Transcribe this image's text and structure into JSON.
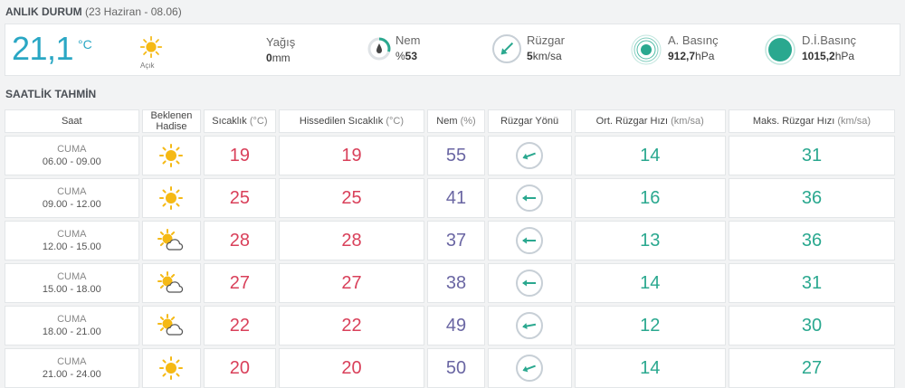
{
  "current": {
    "title": "ANLIK DURUM",
    "subtitle": "(23 Haziran - 08.06)",
    "temperature": "21,1",
    "temp_unit": "°C",
    "condition": "Açık",
    "rain_label": "Yağış",
    "rain_value": "0",
    "rain_unit": "mm",
    "humidity_label": "Nem",
    "humidity_prefix": "%",
    "humidity_value": "53",
    "wind_label": "Rüzgar",
    "wind_value": "5",
    "wind_unit": "km/sa",
    "pressure_label": "A. Basınç",
    "pressure_value": "912,7",
    "pressure_unit": "hPa",
    "sea_pressure_label": "D.İ.Basınç",
    "sea_pressure_value": "1015,2",
    "sea_pressure_unit": "hPa"
  },
  "forecast": {
    "title": "SAATLİK TAHMİN",
    "headers": {
      "time": "Saat",
      "weather_line1": "Beklenen",
      "weather_line2": "Hadise",
      "temp": "Sıcaklık",
      "temp_unit": "(°C)",
      "feels": "Hissedilen Sıcaklık",
      "feels_unit": "(°C)",
      "humidity": "Nem",
      "humidity_unit": "(%)",
      "wind_dir": "Rüzgar Yönü",
      "avg_wind": "Ort. Rüzgar Hızı",
      "avg_wind_unit": "(km/sa)",
      "max_wind": "Maks. Rüzgar Hızı",
      "max_wind_unit": "(km/sa)"
    },
    "rows": [
      {
        "day": "CUMA",
        "hours": "06.00 - 09.00",
        "icon": "sun-icon",
        "temp": "19",
        "feels": "19",
        "humidity": "55",
        "wind_angle": 70,
        "avg_wind": "14",
        "max_wind": "31"
      },
      {
        "day": "CUMA",
        "hours": "09.00 - 12.00",
        "icon": "sun-icon",
        "temp": "25",
        "feels": "25",
        "humidity": "41",
        "wind_angle": 90,
        "avg_wind": "16",
        "max_wind": "36"
      },
      {
        "day": "CUMA",
        "hours": "12.00 - 15.00",
        "icon": "partly-cloudy-icon",
        "temp": "28",
        "feels": "28",
        "humidity": "37",
        "wind_angle": 90,
        "avg_wind": "13",
        "max_wind": "36"
      },
      {
        "day": "CUMA",
        "hours": "15.00 - 18.00",
        "icon": "partly-cloudy-icon",
        "temp": "27",
        "feels": "27",
        "humidity": "38",
        "wind_angle": 90,
        "avg_wind": "14",
        "max_wind": "31"
      },
      {
        "day": "CUMA",
        "hours": "18.00 - 21.00",
        "icon": "partly-cloudy-icon",
        "temp": "22",
        "feels": "22",
        "humidity": "49",
        "wind_angle": 80,
        "avg_wind": "12",
        "max_wind": "30"
      },
      {
        "day": "CUMA",
        "hours": "21.00 - 24.00",
        "icon": "sun-icon",
        "temp": "20",
        "feels": "20",
        "humidity": "50",
        "wind_angle": 70,
        "avg_wind": "14",
        "max_wind": "27"
      }
    ]
  },
  "colors": {
    "temperature": "#2aa7c4",
    "hot": "#d9405a",
    "humidity": "#6a66a3",
    "wind": "#2aa88f",
    "sun": "#f5b915"
  }
}
